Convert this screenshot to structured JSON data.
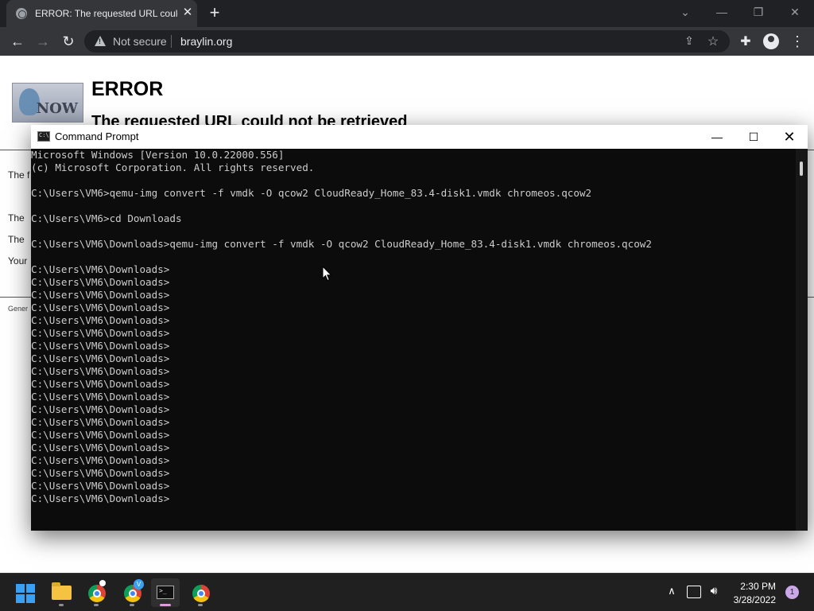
{
  "browser": {
    "tab_title": "ERROR: The requested URL could not be retrieved",
    "security_label": "Not secure",
    "url": "braylin.org",
    "icons": [
      "globe-icon",
      "close-icon",
      "plus-icon",
      "chevron-down-icon",
      "minimize-icon",
      "restore-icon",
      "close-icon",
      "back-arrow-icon",
      "forward-arrow-icon",
      "reload-icon",
      "warning-icon",
      "share-icon",
      "star-icon",
      "puzzle-icon",
      "profile-icon",
      "kebab-menu-icon"
    ]
  },
  "page": {
    "logo_text": "NOW",
    "heading": "ERROR",
    "subheading": "The requested URL could not be retrieved",
    "fragments": [
      "The f",
      "The",
      "The",
      "Your",
      "Gener"
    ]
  },
  "cmd": {
    "title": "Command Prompt",
    "lines": [
      "Microsoft Windows [Version 10.0.22000.556]",
      "(c) Microsoft Corporation. All rights reserved.",
      "",
      "C:\\Users\\VM6>qemu-img convert -f vmdk -O qcow2 CloudReady_Home_83.4-disk1.vmdk chromeos.qcow2",
      "",
      "C:\\Users\\VM6>cd Downloads",
      "",
      "C:\\Users\\VM6\\Downloads>qemu-img convert -f vmdk -O qcow2 CloudReady_Home_83.4-disk1.vmdk chromeos.qcow2",
      "",
      "C:\\Users\\VM6\\Downloads>",
      "C:\\Users\\VM6\\Downloads>",
      "C:\\Users\\VM6\\Downloads>",
      "C:\\Users\\VM6\\Downloads>",
      "C:\\Users\\VM6\\Downloads>",
      "C:\\Users\\VM6\\Downloads>",
      "C:\\Users\\VM6\\Downloads>",
      "C:\\Users\\VM6\\Downloads>",
      "C:\\Users\\VM6\\Downloads>",
      "C:\\Users\\VM6\\Downloads>",
      "C:\\Users\\VM6\\Downloads>",
      "C:\\Users\\VM6\\Downloads>",
      "C:\\Users\\VM6\\Downloads>",
      "C:\\Users\\VM6\\Downloads>",
      "C:\\Users\\VM6\\Downloads>",
      "C:\\Users\\VM6\\Downloads>",
      "C:\\Users\\VM6\\Downloads>",
      "C:\\Users\\VM6\\Downloads>",
      "C:\\Users\\VM6\\Downloads>"
    ]
  },
  "taskbar": {
    "apps": [
      "start-menu",
      "file-explorer",
      "chrome",
      "chrome",
      "terminal",
      "chrome"
    ],
    "badge_letter": "V",
    "time": "2:30 PM",
    "date": "3/28/2022",
    "notification_count": "1"
  },
  "colors": {
    "console_bg": "#0c0c0c",
    "console_text": "#cccccc",
    "browser_frame": "#202124",
    "taskbar": "#202020",
    "accent": "#3aa0f3"
  }
}
